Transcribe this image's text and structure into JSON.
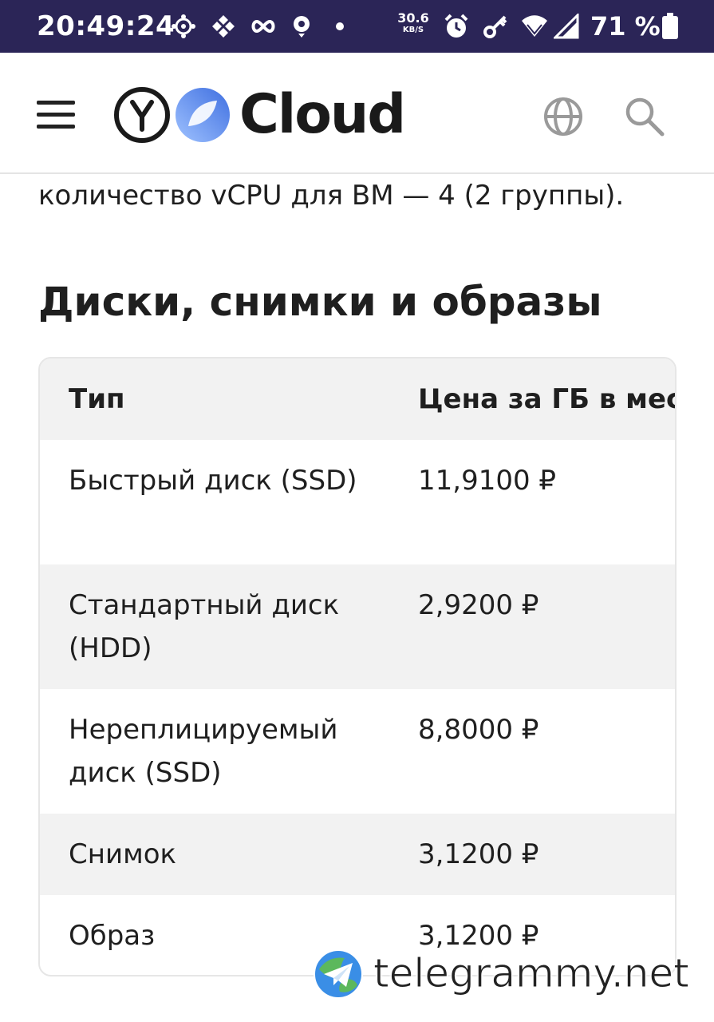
{
  "status_bar": {
    "time": "20:49:24",
    "net_speed_value": "30.6",
    "net_speed_unit": "KB/S",
    "battery_percent": "71 %",
    "icons": [
      "app-icon",
      "binance-icon",
      "infinity-icon",
      "location-icon",
      "dot-icon",
      "alarm-icon",
      "key-icon",
      "wifi-icon",
      "signal-icon",
      "battery-icon"
    ]
  },
  "header": {
    "logo_text": "Cloud",
    "menu_icon": "hamburger-menu-icon",
    "language_icon": "globe-icon",
    "search_icon": "search-icon"
  },
  "content": {
    "previous_paragraph_tail": "количество vCPU для ВМ — 4 (2 группы).",
    "section_title": "Диски, снимки и образы",
    "table": {
      "columns": [
        "Тип",
        "Цена за ГБ в мес"
      ],
      "rows": [
        {
          "type": "Быстрый диск (SSD)",
          "price": "11,9100 ₽"
        },
        {
          "type": "Стандартный диск (HDD)",
          "price": "2,9200 ₽"
        },
        {
          "type": "Нереплицируемый диск (SSD)",
          "price": "8,8000 ₽"
        },
        {
          "type": "Снимок",
          "price": "3,1200 ₽"
        },
        {
          "type": "Образ",
          "price": "3,1200 ₽"
        }
      ]
    }
  },
  "watermark": {
    "text": "telegrammy.net"
  },
  "colors": {
    "status_bar_bg": "#2b2557",
    "row_shade": "#f2f2f2",
    "logo_blue": "#5b8cf0"
  }
}
